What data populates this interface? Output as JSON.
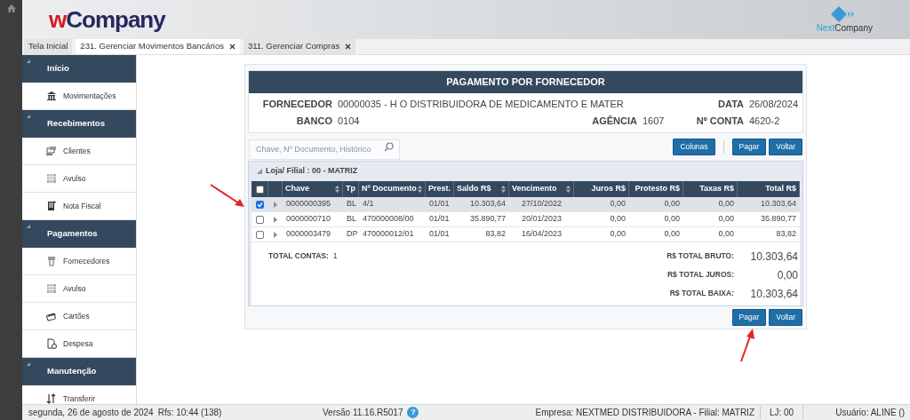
{
  "header": {
    "logo": {
      "prefix": "w",
      "name": "Company"
    },
    "partner_logo": {
      "prefix": "Next",
      "name": "Company"
    }
  },
  "tabs": [
    {
      "label": "Tela Inicial",
      "selected": false,
      "closable": false
    },
    {
      "label": "231. Gerenciar Movimentos Bancários",
      "selected": true,
      "closable": true
    },
    {
      "label": "311. Gerenciar Compras",
      "selected": false,
      "closable": true
    }
  ],
  "sidebar": {
    "sections": [
      {
        "title": "Início",
        "items": [
          {
            "label": "Movimentações"
          }
        ]
      },
      {
        "title": "Recebimentos",
        "items": [
          {
            "label": "Clientes"
          },
          {
            "label": "Avulso"
          },
          {
            "label": "Nota Fiscal"
          }
        ]
      },
      {
        "title": "Pagamentos",
        "items": [
          {
            "label": "Fornecedores"
          },
          {
            "label": "Avulso"
          },
          {
            "label": "Cartões"
          },
          {
            "label": "Despesa"
          }
        ]
      },
      {
        "title": "Manutenção",
        "items": [
          {
            "label": "Transferir"
          }
        ]
      }
    ]
  },
  "panel": {
    "title": "PAGAMENTO POR FORNECEDOR",
    "info_rows": [
      [
        {
          "label": "FORNECEDOR",
          "value": "00000035 - H O DISTRIBUIDORA DE MEDICAMENTO E MATER"
        },
        {
          "label": "DATA",
          "value": "26/08/2024"
        }
      ],
      [
        {
          "label": "BANCO",
          "value": "0104"
        },
        {
          "label": "AGÊNCIA",
          "value": "1607"
        },
        {
          "label": "Nº CONTA",
          "value": "4620-2"
        }
      ]
    ],
    "search": {
      "placeholder": "Chave, Nº Documento, Histórico"
    },
    "toolbar_buttons": [
      "Colunas",
      "Pagar",
      "Voltar"
    ],
    "group": {
      "title": "Loja/ Filial : 00 - MATRIZ",
      "header_checked": false,
      "columns": [
        {
          "label": "Chave",
          "sortable": true
        },
        {
          "label": "Tp",
          "sortable": false
        },
        {
          "label": "Nº Documento",
          "sortable": true
        },
        {
          "label": "Prest.",
          "sortable": false
        },
        {
          "label": "Saldo R$",
          "sortable": true
        },
        {
          "label": "Vencimento",
          "sortable": true
        },
        {
          "label": "Juros R$",
          "sortable": false
        },
        {
          "label": "Protesto R$",
          "sortable": false
        },
        {
          "label": "Taxas R$",
          "sortable": false
        },
        {
          "label": "Total R$",
          "sortable": false
        }
      ],
      "rows": [
        {
          "selected": true,
          "cells": [
            "0000000395",
            "BL",
            "4/1",
            "01/01",
            "10.303,64",
            "27/10/2022",
            "0,00",
            "0,00",
            "0,00",
            "10.303,64"
          ]
        },
        {
          "selected": false,
          "cells": [
            "0000000710",
            "BL",
            "470000008/00",
            "01/01",
            "35.890,77",
            "20/01/2023",
            "0,00",
            "0,00",
            "0,00",
            "35.890,77"
          ]
        },
        {
          "selected": false,
          "cells": [
            "0000003479",
            "DP",
            "470000012/01",
            "01/01",
            "83,82",
            "16/04/2023",
            "0,00",
            "0,00",
            "0,00",
            "83,82"
          ]
        }
      ],
      "total_contas": {
        "label": "TOTAL CONTAS:",
        "value": "1"
      },
      "totals": [
        {
          "label": "R$ TOTAL BRUTO:",
          "value": "10.303,64"
        },
        {
          "label": "R$ TOTAL JUROS:",
          "value": "0,00"
        },
        {
          "label": "R$ TOTAL BAIXA:",
          "value": "10.303,64"
        }
      ]
    },
    "footer_buttons": [
      "Pagar",
      "Voltar"
    ]
  },
  "status_bar": {
    "date": "segunda, 26 de agosto de 2024",
    "refresh": "Rfs: 10:44 (138)",
    "version": "Versão 11.16.R5017",
    "help": "?",
    "company": "Empresa: NEXTMED DISTRIBUIDORA - Filial: MATRIZ",
    "store": "LJ: 00",
    "user": "Usuário: ALINE ()"
  }
}
